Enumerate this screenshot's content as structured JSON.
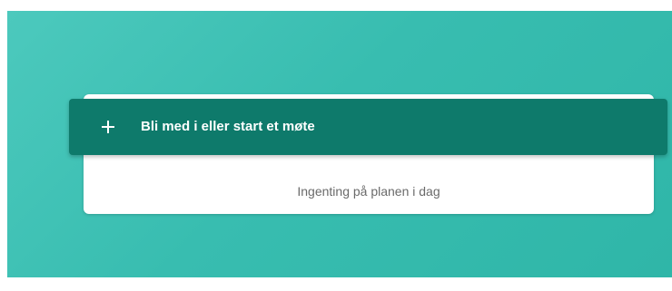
{
  "join_bar": {
    "label": "Bli med i eller start et møte",
    "icon": "plus-icon"
  },
  "agenda": {
    "empty_text": "Ingenting på planen i dag"
  },
  "colors": {
    "background_accent": "#38bdb0",
    "join_bar": "#0e7a6b",
    "card": "#ffffff",
    "empty_text": "#6a6a6a"
  }
}
